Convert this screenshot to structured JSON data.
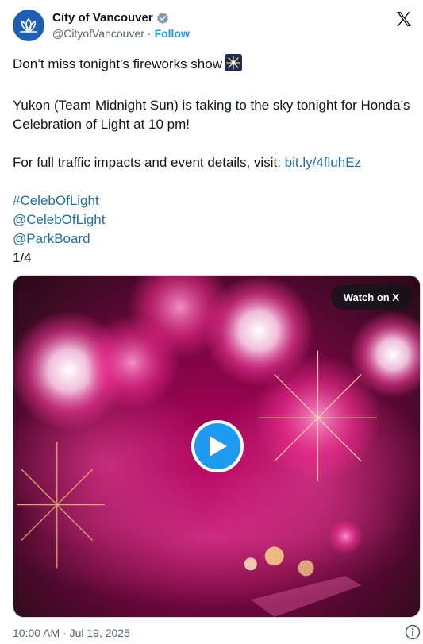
{
  "author": {
    "display_name": "City of Vancouver",
    "handle": "@CityofVancouver",
    "separator": "·",
    "follow_label": "Follow",
    "verified_icon": "verified-badge-icon"
  },
  "tweet": {
    "line1": "Don’t miss tonight's fireworks show",
    "line2": "Yukon (Team Midnight Sun) is taking to the sky tonight for Honda’s Celebration of Light at 10 pm!",
    "line3_text": "For full traffic impacts and event details, visit: ",
    "line3_link": "bit.ly/4fluhEz",
    "hashtag1": "#CelebOfLight",
    "mention1": "@CelebOfLight",
    "mention2": "@ParkBoard",
    "counter": "1/4"
  },
  "media": {
    "watch_label": "Watch on X",
    "play_icon": "play-icon"
  },
  "footer": {
    "timestamp": "10:00 AM · Jul 19, 2025",
    "info_icon": "info-icon"
  },
  "colors": {
    "link": "#1d9bf0",
    "text": "#0f1419",
    "muted": "#536471",
    "avatar": "#1d5fb4"
  }
}
